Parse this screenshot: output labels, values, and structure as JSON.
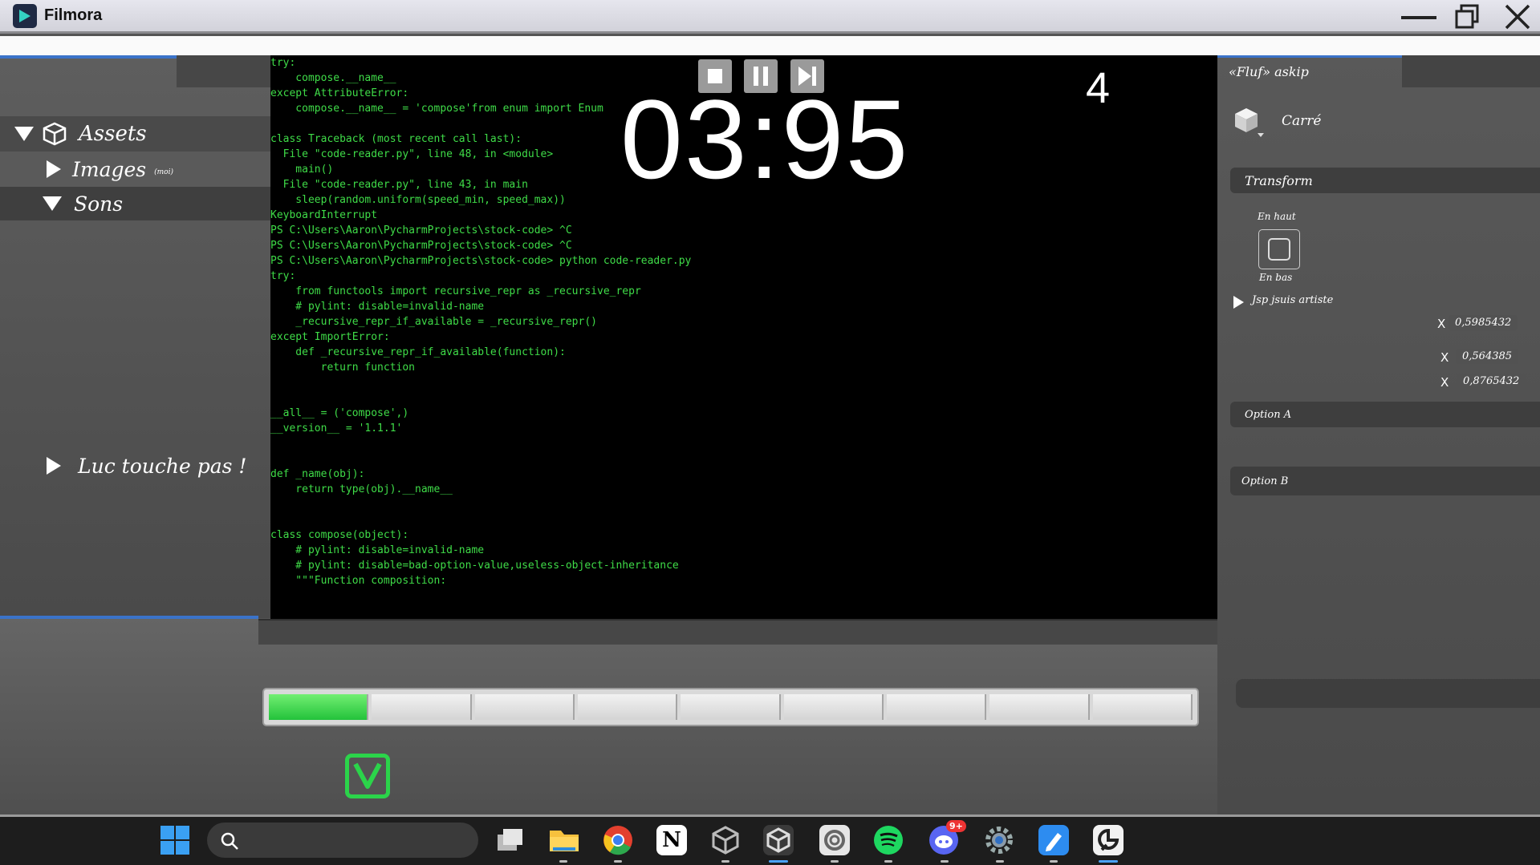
{
  "window": {
    "app_name": "Filmora",
    "minimize_glyph": "—",
    "close_glyph": "✕"
  },
  "left_panel": {
    "assets_label": "Assets",
    "images_label": "Images",
    "images_badge": "(moi)",
    "sounds_label": "Sons",
    "luc_label": "Luc touche pas !"
  },
  "terminal": {
    "code_lines": [
      "try:",
      "    compose.__name__",
      "except AttributeError:",
      "    compose.__name__ = 'compose'from enum import Enum",
      "",
      "class Traceback (most recent call last):",
      "  File \"code-reader.py\", line 48, in <module>",
      "    main()",
      "  File \"code-reader.py\", line 43, in main",
      "    sleep(random.uniform(speed_min, speed_max))",
      "KeyboardInterrupt",
      "PS C:\\Users\\Aaron\\PycharmProjects\\stock-code> ^C",
      "PS C:\\Users\\Aaron\\PycharmProjects\\stock-code> ^C",
      "PS C:\\Users\\Aaron\\PycharmProjects\\stock-code> python code-reader.py",
      "try:",
      "    from functools import recursive_repr as _recursive_repr",
      "    # pylint: disable=invalid-name",
      "    _recursive_repr_if_available = _recursive_repr()",
      "except ImportError:",
      "    def _recursive_repr_if_available(function):",
      "        return function",
      "",
      "",
      "__all__ = ('compose',)",
      "__version__ = '1.1.1'",
      "",
      "",
      "def _name(obj):",
      "    return type(obj).__name__",
      "",
      "",
      "class compose(object):",
      "    # pylint: disable=invalid-name",
      "    # pylint: disable=bad-option-value,useless-object-inheritance",
      "    \"\"\"Function composition:"
    ],
    "timer": "03:95",
    "counter": "4"
  },
  "right_panel": {
    "header": "«Fluf» askip",
    "object_name": "Carré",
    "transform_label": "Transform",
    "top_label": "En haut",
    "bottom_label": "En bas",
    "artist_label": "Jsp jsuis artiste",
    "x_rows": [
      {
        "label": "X",
        "value": "0,5985432"
      },
      {
        "label": "X",
        "value": "0,564385"
      },
      {
        "label": "X",
        "value": "0,8765432"
      }
    ],
    "option_a": "Option A",
    "option_b": "Option B"
  },
  "progress": {
    "total_segments": 9,
    "filled_segments": 1,
    "fill_color": "#2bd44a"
  },
  "taskbar": {
    "discord_badge": "9+",
    "notion_letter": "N",
    "icons": [
      "windows-start-icon",
      "search-icon",
      "task-view-icon",
      "file-explorer-icon",
      "chrome-icon",
      "notion-icon",
      "unity-icon",
      "unity-hub-icon",
      "ccleaner-icon",
      "spotify-icon",
      "discord-icon",
      "settings-icon",
      "paint-icon",
      "clip-studio-icon"
    ]
  }
}
